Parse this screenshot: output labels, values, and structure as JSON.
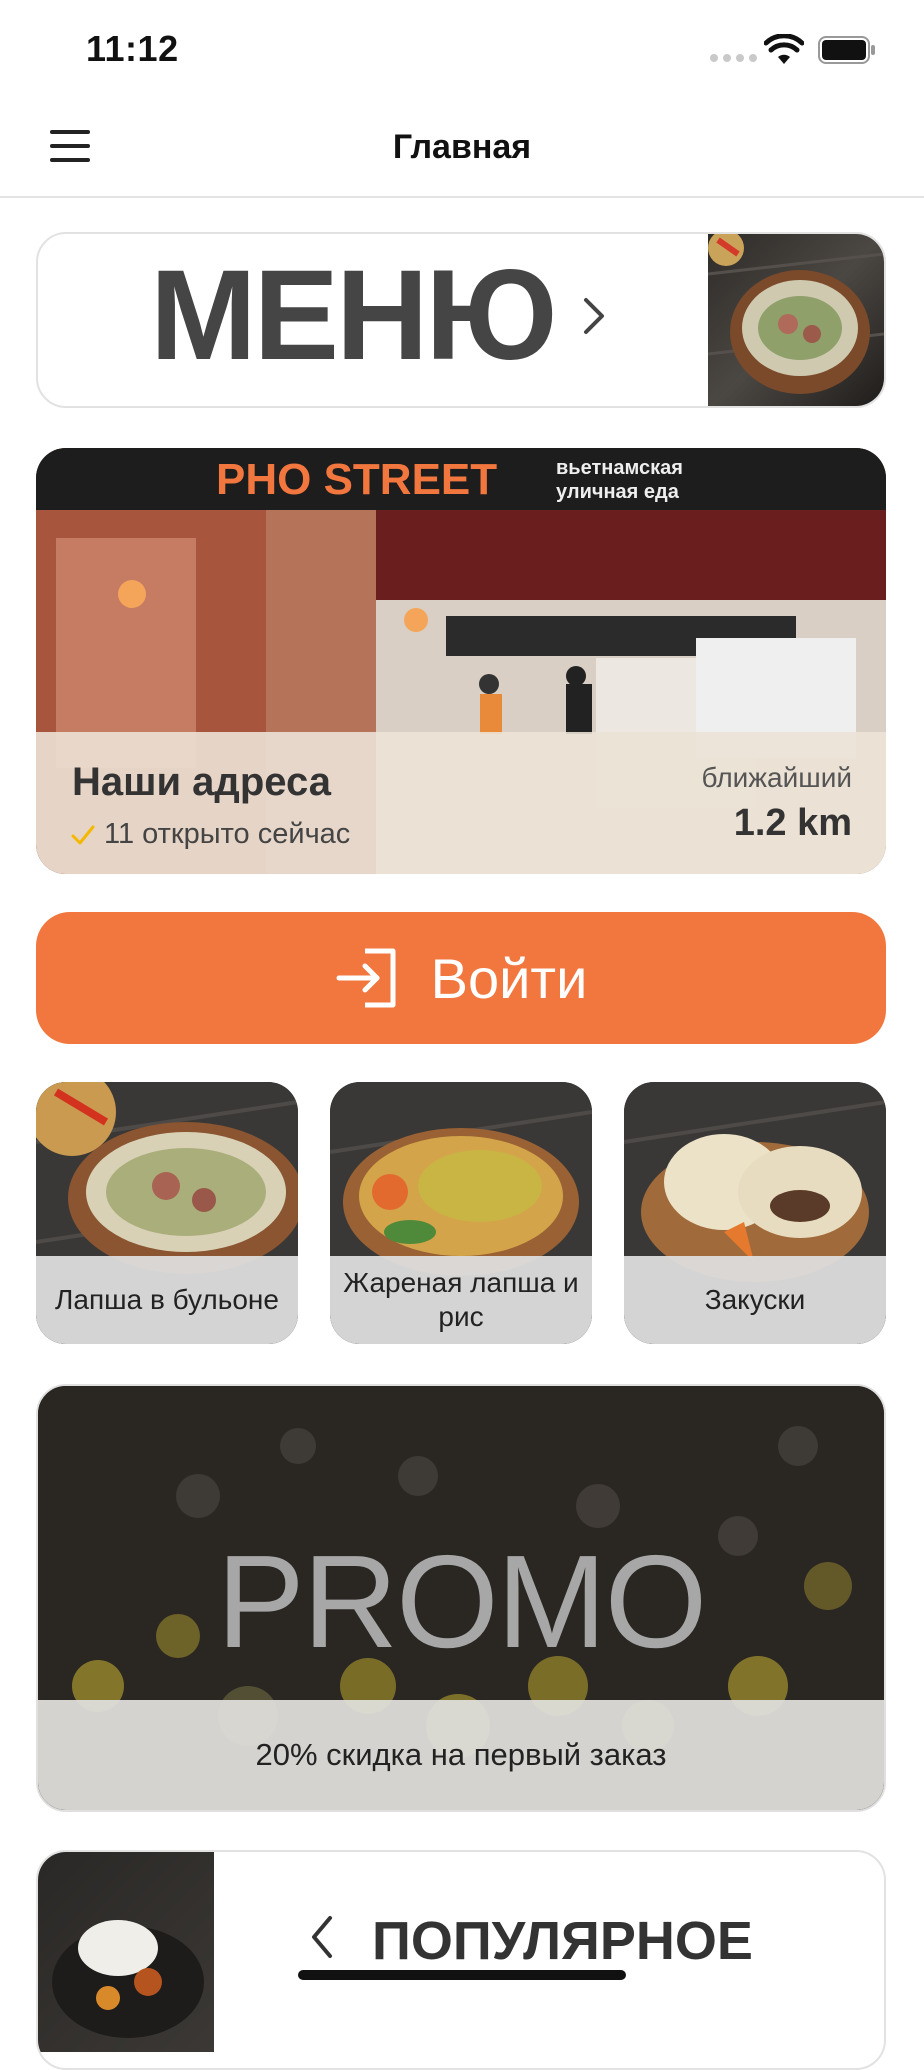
{
  "status_bar": {
    "time": "11:12"
  },
  "nav": {
    "title": "Главная"
  },
  "menu_card": {
    "label": "МЕНЮ"
  },
  "addresses": {
    "title": "Наши адреса",
    "open_now": "11 открыто сейчас",
    "nearest_label": "ближайший",
    "nearest_distance": "1.2 km",
    "sign_brand": "PHO STREET",
    "sign_tagline_1": "вьетнамская",
    "sign_tagline_2": "уличная еда"
  },
  "login": {
    "label": "Войти"
  },
  "categories": [
    {
      "label": "Лапша в бульоне"
    },
    {
      "label": "Жареная лапша и рис"
    },
    {
      "label": "Закуски"
    }
  ],
  "promo": {
    "big_text": "PROMO",
    "caption": "20% скидка на первый заказ"
  },
  "popular": {
    "label": "ПОПУЛЯРНОЕ"
  },
  "colors": {
    "accent": "#f2773f",
    "check": "#f5b800"
  }
}
